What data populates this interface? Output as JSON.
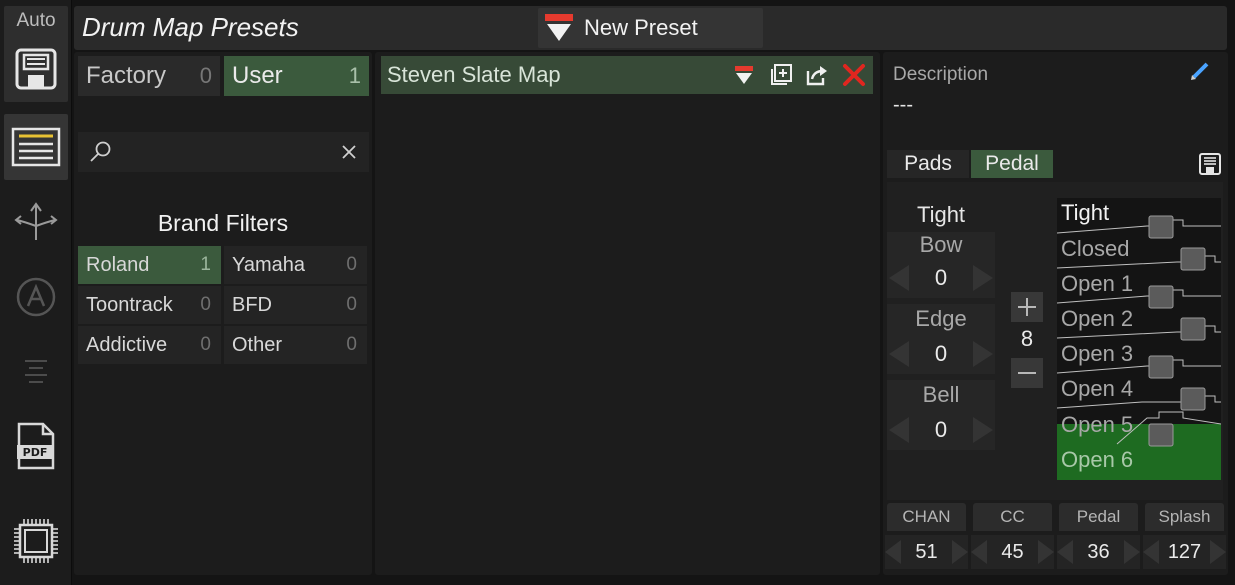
{
  "header": {
    "title": "Drum Map Presets",
    "new_preset_label": "New Preset"
  },
  "toolbar": {
    "auto_label": "Auto",
    "icons": [
      "save-icon",
      "list-icon",
      "routing-icon",
      "assign-icon",
      "lines-icon",
      "pdf-icon",
      "chip-icon"
    ],
    "pdf_text": "PDF"
  },
  "library": {
    "tabs": [
      {
        "label": "Factory",
        "count": "0",
        "selected": false
      },
      {
        "label": "User",
        "count": "1",
        "selected": true
      }
    ],
    "search": {
      "value": "",
      "placeholder": ""
    },
    "brand_filters_title": "Brand Filters",
    "brands": [
      {
        "name": "Roland",
        "count": "1",
        "selected": true
      },
      {
        "name": "Yamaha",
        "count": "0",
        "selected": false
      },
      {
        "name": "Toontrack",
        "count": "0",
        "selected": false
      },
      {
        "name": "BFD",
        "count": "0",
        "selected": false
      },
      {
        "name": "Addictive",
        "count": "0",
        "selected": false
      },
      {
        "name": "Other",
        "count": "0",
        "selected": false
      }
    ]
  },
  "preset_list": {
    "items": [
      {
        "name": "Steven Slate Map",
        "selected": true
      }
    ]
  },
  "details": {
    "description_label": "Description",
    "description_value": "---",
    "tabs": [
      {
        "label": "Pads",
        "selected": false
      },
      {
        "label": "Pedal",
        "selected": true
      }
    ],
    "pedal": {
      "zone_header": "Tight",
      "zones": [
        {
          "label": "Bow",
          "value": "0"
        },
        {
          "label": "Edge",
          "value": "0"
        },
        {
          "label": "Bell",
          "value": "0"
        }
      ],
      "stepper_value": "8",
      "levels": [
        "Tight",
        "Closed",
        "Open 1",
        "Open 2",
        "Open 3",
        "Open 4",
        "Open 5",
        "Open 6"
      ],
      "selected_level": "Open 6"
    },
    "controls": [
      {
        "label": "CHAN",
        "value": "51"
      },
      {
        "label": "CC",
        "value": "45"
      },
      {
        "label": "Pedal",
        "value": "36"
      },
      {
        "label": "Splash",
        "value": "127"
      }
    ]
  },
  "colors": {
    "accent_green": "#3b5a3d",
    "selected_level_green": "#1e6b21",
    "danger_red": "#e0261f",
    "download_red": "#e53a2e",
    "pencil_blue": "#4aa3ff"
  }
}
